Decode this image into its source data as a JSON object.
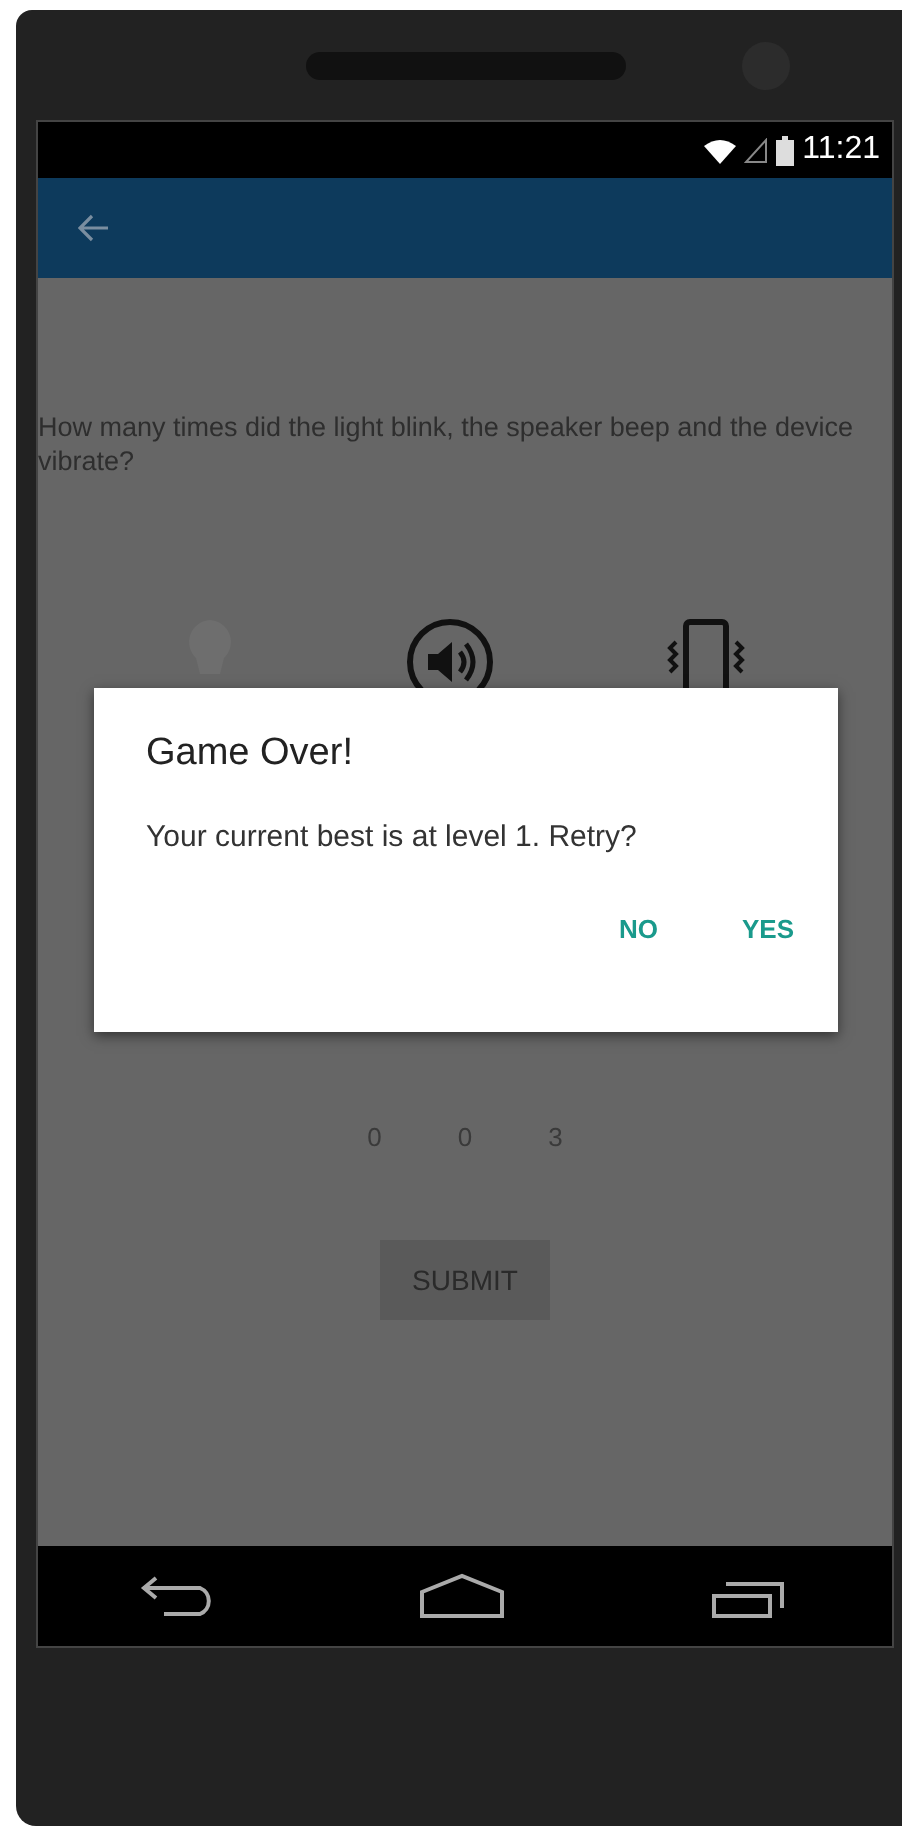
{
  "status_bar": {
    "time": "11:21"
  },
  "question": "How many times did the light blink, the speaker beep and the device vibrate?",
  "counts": [
    "0",
    "0",
    "3"
  ],
  "submit": "SUBMIT",
  "dialog": {
    "title": "Game Over!",
    "message": "Your current best is at level 1. Retry?",
    "buttons": [
      "NO",
      "YES"
    ]
  }
}
